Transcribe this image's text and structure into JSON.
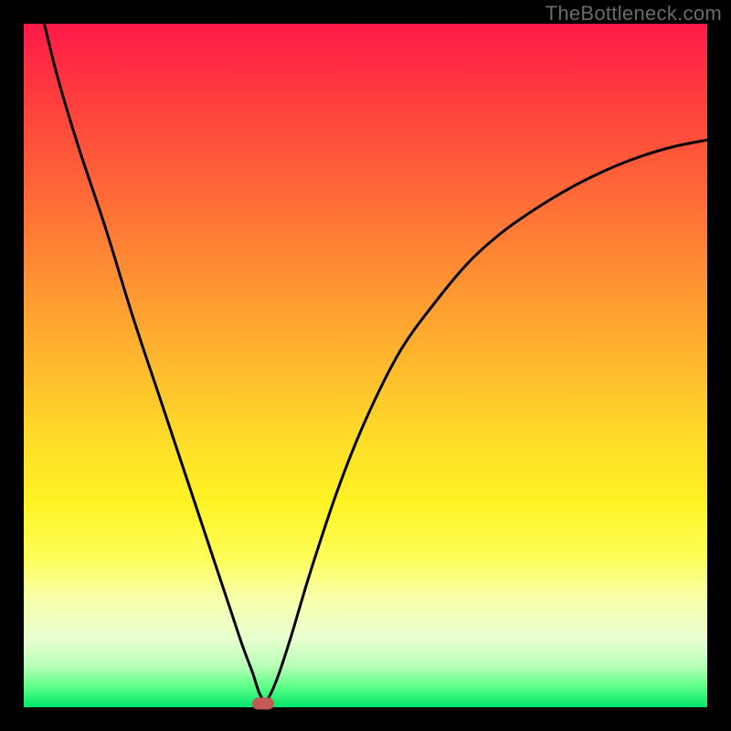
{
  "watermark": "TheBottleneck.com",
  "chart_data": {
    "type": "line",
    "title": "",
    "xlabel": "",
    "ylabel": "",
    "xlim": [
      0,
      100
    ],
    "ylim": [
      0,
      100
    ],
    "series": [
      {
        "name": "bottleneck-curve",
        "x": [
          3,
          5,
          8,
          12,
          16,
          20,
          24,
          27,
          30,
          32,
          33.5,
          34.5,
          35.5,
          37,
          39,
          42,
          46,
          50,
          55,
          60,
          65,
          70,
          75,
          80,
          85,
          90,
          95,
          100
        ],
        "y": [
          100,
          92,
          82,
          70,
          57,
          45,
          33,
          24,
          15,
          9,
          5,
          2,
          1,
          4,
          10,
          20,
          32,
          42,
          52,
          59,
          65,
          69.5,
          73,
          76,
          78.5,
          80.5,
          82,
          83
        ]
      }
    ],
    "marker": {
      "x": 35,
      "y": 0.5
    },
    "colors": {
      "curve": "#000000",
      "marker": "#c45a56",
      "gradient_top": "#ff1a49",
      "gradient_bottom": "#00e66a"
    }
  }
}
